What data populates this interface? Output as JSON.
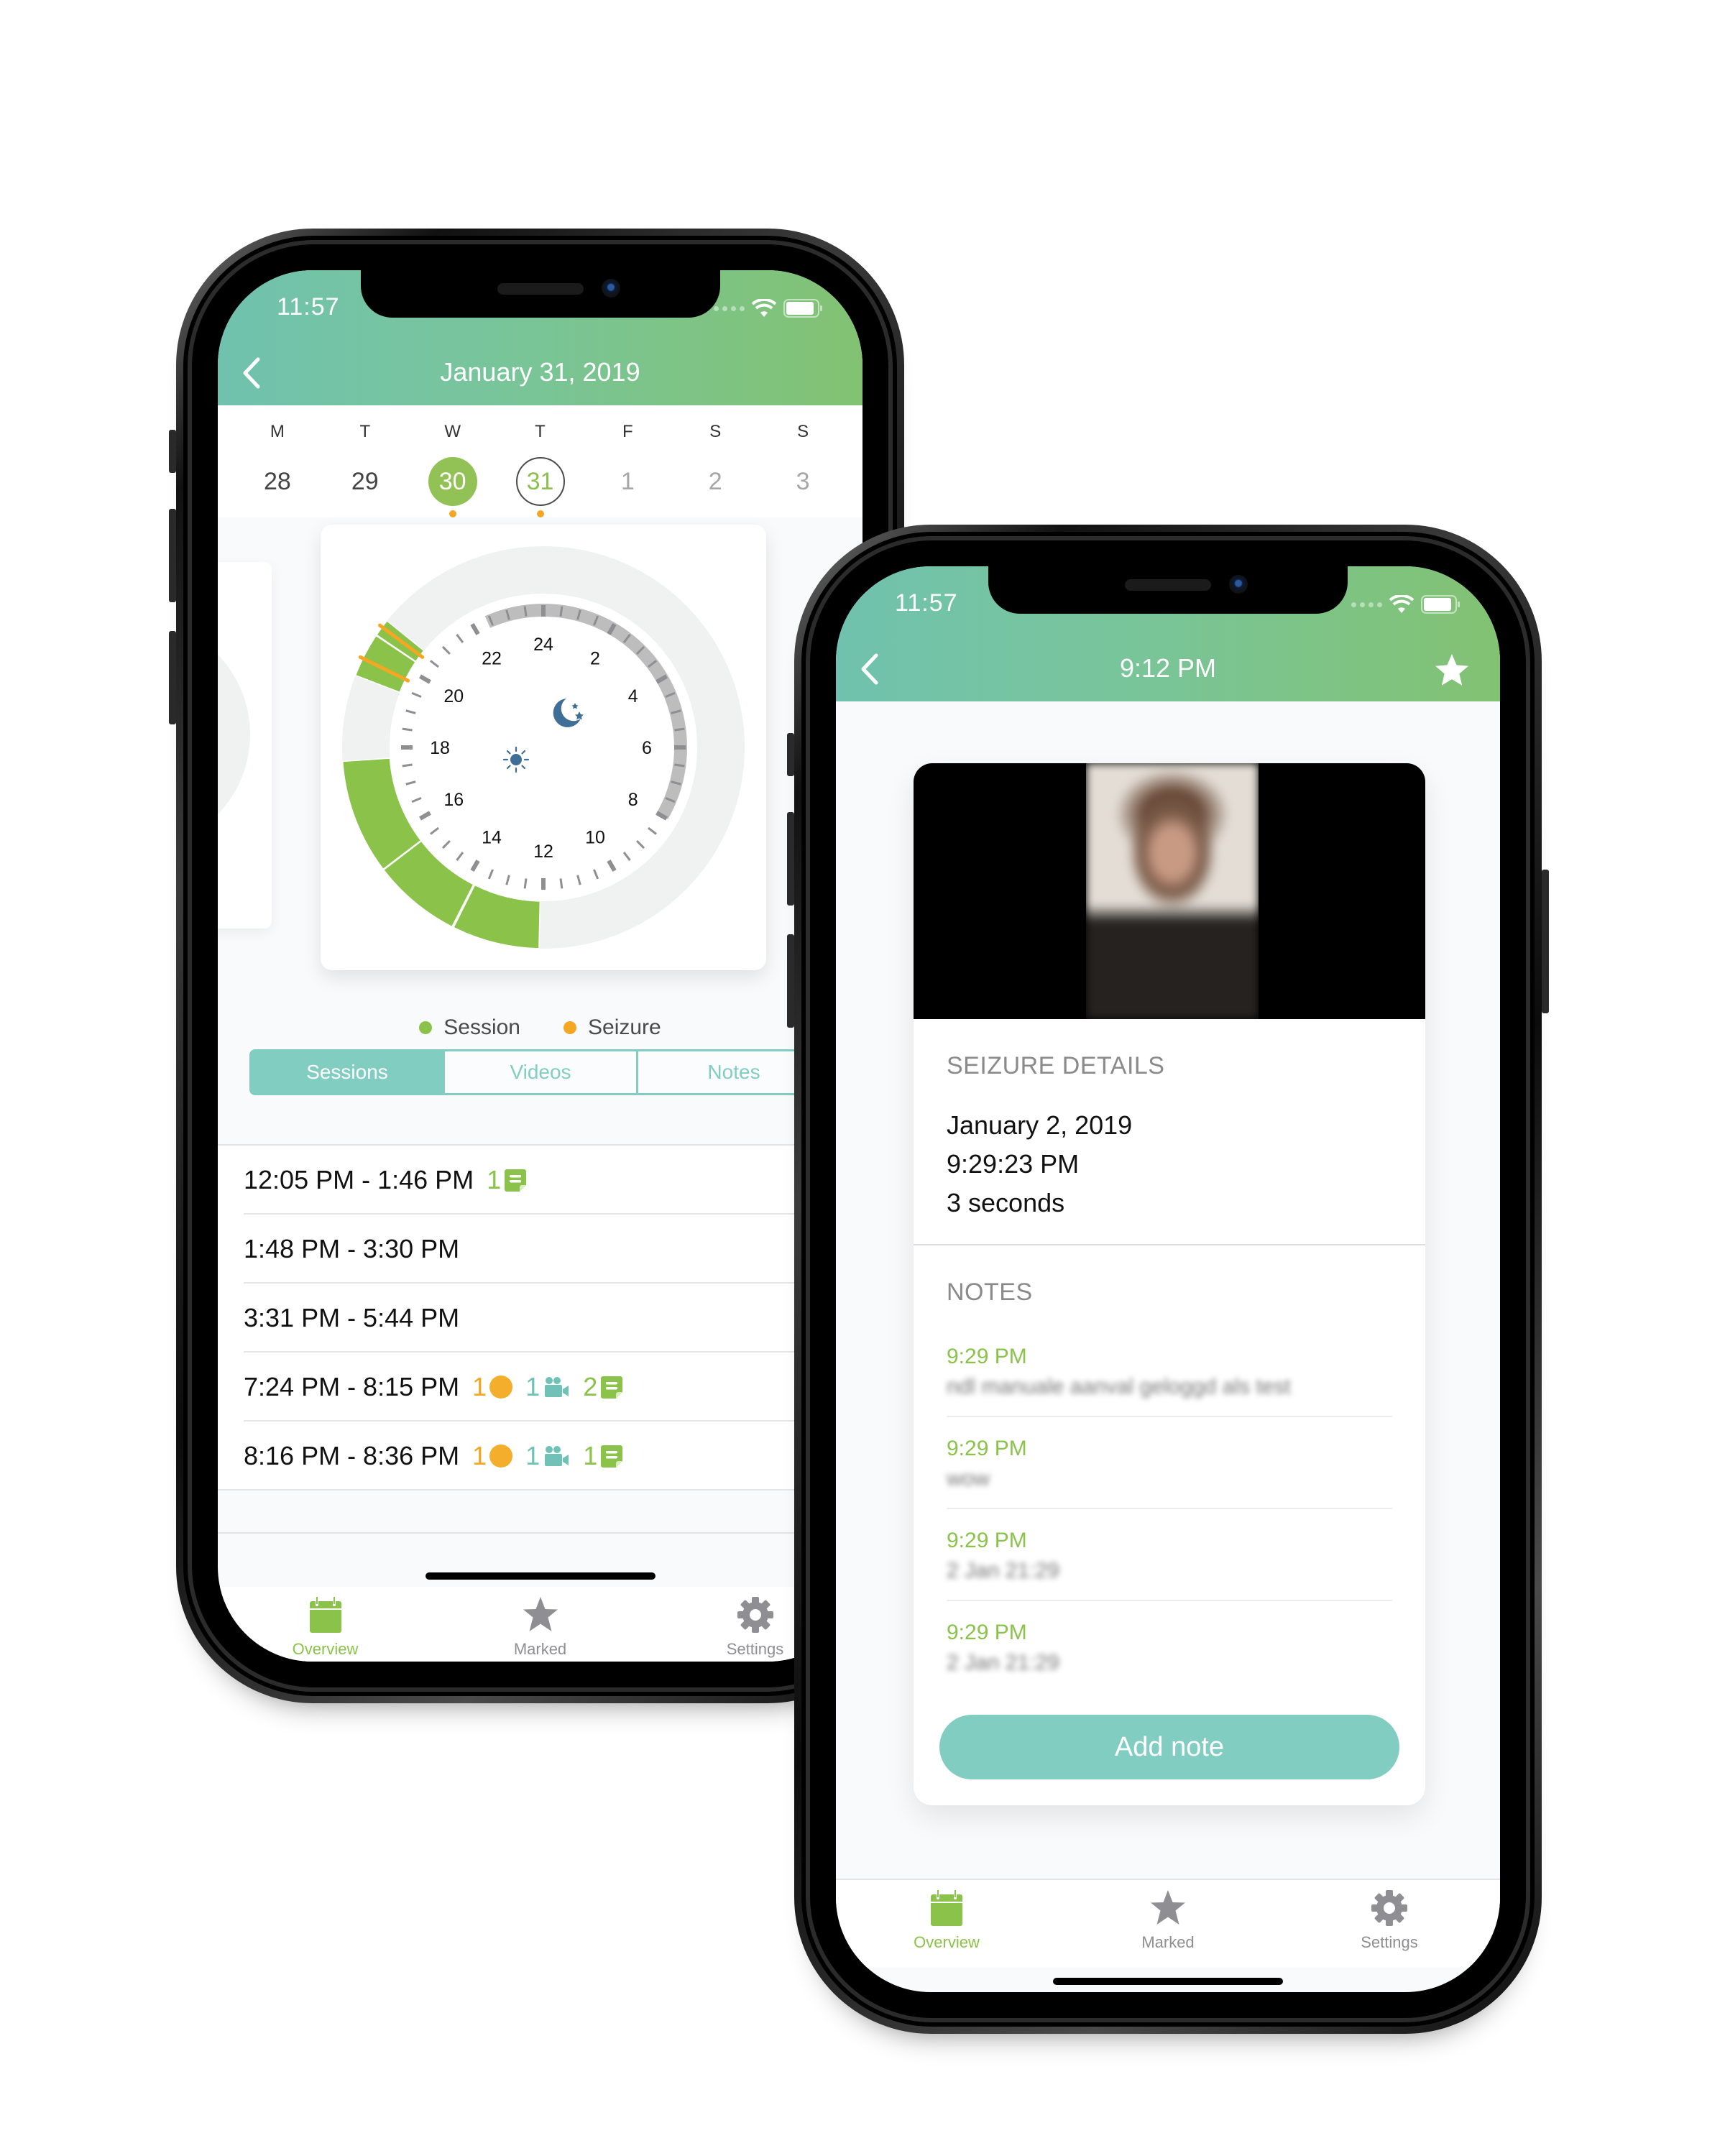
{
  "colors": {
    "header_start": "#70c2ae",
    "header_end": "#82c272",
    "session_green": "#8bc34a",
    "seizure_orange": "#f5a623",
    "video_teal": "#6fc2b5",
    "tab_active": "#8bc34a",
    "tab_inactive": "#8e8e93",
    "accent_teal": "#82cdc1",
    "night_band": "#bdbdbd",
    "icon_blue": "#3f6f96"
  },
  "left_phone": {
    "status_time": "11:57",
    "nav_title": "January 31, 2019",
    "week": {
      "days": [
        "M",
        "T",
        "W",
        "T",
        "F",
        "S",
        "S"
      ],
      "dates": [
        {
          "num": "28",
          "state": "past",
          "has_seizure": false
        },
        {
          "num": "29",
          "state": "past",
          "has_seizure": false
        },
        {
          "num": "30",
          "state": "selected",
          "has_seizure": true
        },
        {
          "num": "31",
          "state": "today",
          "has_seizure": true
        },
        {
          "num": "1",
          "state": "future",
          "has_seizure": false
        },
        {
          "num": "2",
          "state": "future",
          "has_seizure": false
        },
        {
          "num": "3",
          "state": "future",
          "has_seizure": false
        }
      ]
    },
    "clock": {
      "hour_labels": [
        "24",
        "2",
        "4",
        "6",
        "8",
        "10",
        "12",
        "14",
        "16",
        "18",
        "20",
        "22"
      ],
      "night_band_hours": [
        22.4,
        8.0
      ],
      "sessions": [
        {
          "start": 12.083,
          "end": 13.767
        },
        {
          "start": 13.8,
          "end": 15.5
        },
        {
          "start": 15.517,
          "end": 17.733
        },
        {
          "start": 19.4,
          "end": 20.25
        },
        {
          "start": 20.267,
          "end": 20.6
        }
      ],
      "seizures": [
        19.75,
        20.45
      ],
      "moon_icon": "moon-stars-icon",
      "sun_icon": "sun-icon"
    },
    "legend": [
      {
        "label": "Session",
        "color": "#8bc34a"
      },
      {
        "label": "Seizure",
        "color": "#f5a623"
      }
    ],
    "segments": [
      {
        "label": "Sessions",
        "active": true
      },
      {
        "label": "Videos",
        "active": false
      },
      {
        "label": "Notes",
        "active": false
      }
    ],
    "sessions": [
      {
        "range": "12:05 PM - 1:46 PM",
        "seizures": null,
        "videos": null,
        "notes": "1"
      },
      {
        "range": "1:48 PM - 3:30 PM",
        "seizures": null,
        "videos": null,
        "notes": null
      },
      {
        "range": "3:31 PM - 5:44 PM",
        "seizures": null,
        "videos": null,
        "notes": null
      },
      {
        "range": "7:24 PM - 8:15 PM",
        "seizures": "1",
        "videos": "1",
        "notes": "2"
      },
      {
        "range": "8:16 PM - 8:36 PM",
        "seizures": "1",
        "videos": "1",
        "notes": "1"
      }
    ],
    "tabs": [
      {
        "label": "Overview",
        "icon": "calendar-icon",
        "active": true
      },
      {
        "label": "Marked",
        "icon": "star-icon",
        "active": false
      },
      {
        "label": "Settings",
        "icon": "gear-icon",
        "active": false
      }
    ]
  },
  "right_phone": {
    "status_time": "11:57",
    "nav_title": "9:12 PM",
    "seizure_details": {
      "title": "SEIZURE DETAILS",
      "date": "January 2, 2019",
      "time": "9:29:23 PM",
      "duration": "3 seconds"
    },
    "notes": {
      "title": "NOTES",
      "items": [
        {
          "time": "9:29 PM",
          "body": "[blurred text]"
        },
        {
          "time": "9:29 PM",
          "body": "[blurred text]"
        },
        {
          "time": "9:29 PM",
          "body": "[blurred text]"
        },
        {
          "time": "9:29 PM",
          "body": "[blurred text]"
        }
      ]
    },
    "add_note_label": "Add note",
    "tabs": [
      {
        "label": "Overview",
        "icon": "calendar-icon",
        "active": true
      },
      {
        "label": "Marked",
        "icon": "star-icon",
        "active": false
      },
      {
        "label": "Settings",
        "icon": "gear-icon",
        "active": false
      }
    ]
  }
}
